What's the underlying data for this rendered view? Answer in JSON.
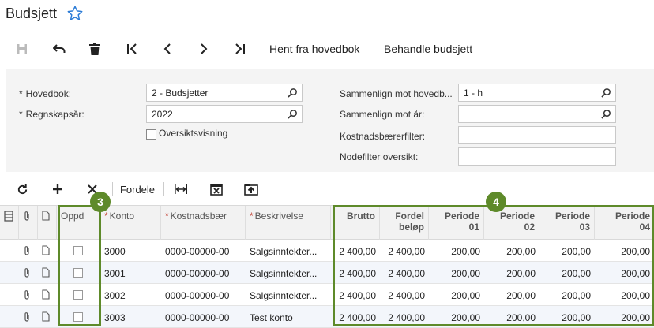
{
  "page": {
    "title": "Budsjett"
  },
  "toolbar": {
    "fetch_label": "Hent fra hovedbok",
    "process_label": "Behandle budsjett"
  },
  "form": {
    "ledger_label": "Hovedbok:",
    "ledger_value": "2 - Budsjetter",
    "year_label": "Regnskapsår:",
    "year_value": "2022",
    "overview_label": "Oversiktsvisning",
    "compare_ledger_label": "Sammenlign mot hovedb...",
    "compare_ledger_value": "1 - h",
    "compare_year_label": "Sammenlign mot år:",
    "compare_year_value": "",
    "cost_filter_label": "Kostnadsbærerfilter:",
    "cost_filter_value": "",
    "node_filter_label": "Nodefilter oversikt:",
    "node_filter_value": ""
  },
  "grid_toolbar": {
    "distribute_label": "Fordele"
  },
  "grid": {
    "headers": {
      "update": "Oppd",
      "account": "Konto",
      "cost": "Kostnadsbær",
      "description": "Beskrivelse",
      "gross": "Brutto",
      "distributed_1": "Fordel",
      "distributed_2": "beløp",
      "p01_1": "Periode",
      "p01_2": "01",
      "p02_1": "Periode",
      "p02_2": "02",
      "p03_1": "Periode",
      "p03_2": "03",
      "p04_1": "Periode",
      "p04_2": "04"
    },
    "rows": [
      {
        "account": "3000",
        "cost": "0000-00000-00",
        "description": "Salgsinntekter...",
        "gross": "2 400,00",
        "distributed": "2 400,00",
        "p01": "200,00",
        "p02": "200,00",
        "p03": "200,00",
        "p04": "200,00"
      },
      {
        "account": "3001",
        "cost": "0000-00000-00",
        "description": "Salgsinntekter...",
        "gross": "2 400,00",
        "distributed": "2 400,00",
        "p01": "200,00",
        "p02": "200,00",
        "p03": "200,00",
        "p04": "200,00"
      },
      {
        "account": "3002",
        "cost": "0000-00000-00",
        "description": "Salgsinntekter...",
        "gross": "2 400,00",
        "distributed": "2 400,00",
        "p01": "200,00",
        "p02": "200,00",
        "p03": "200,00",
        "p04": "200,00"
      },
      {
        "account": "3003",
        "cost": "0000-00000-00",
        "description": "Test konto",
        "gross": "2 400,00",
        "distributed": "2 400,00",
        "p01": "200,00",
        "p02": "200,00",
        "p03": "200,00",
        "p04": "200,00"
      }
    ]
  },
  "callouts": {
    "badge_3": "3",
    "badge_4": "4"
  },
  "colors": {
    "highlight": "#5e8a2a",
    "accent_blue": "#2b7bd6",
    "required_red": "#c0392b"
  },
  "icons": [
    "star-icon",
    "save-icon",
    "undo-icon",
    "delete-icon",
    "first-icon",
    "prev-icon",
    "next-icon",
    "last-icon",
    "refresh-icon",
    "add-icon",
    "remove-icon",
    "fit-columns-icon",
    "export-excel-icon",
    "upload-icon",
    "search-icon",
    "attachment-icon",
    "note-icon",
    "column-settings-icon"
  ]
}
